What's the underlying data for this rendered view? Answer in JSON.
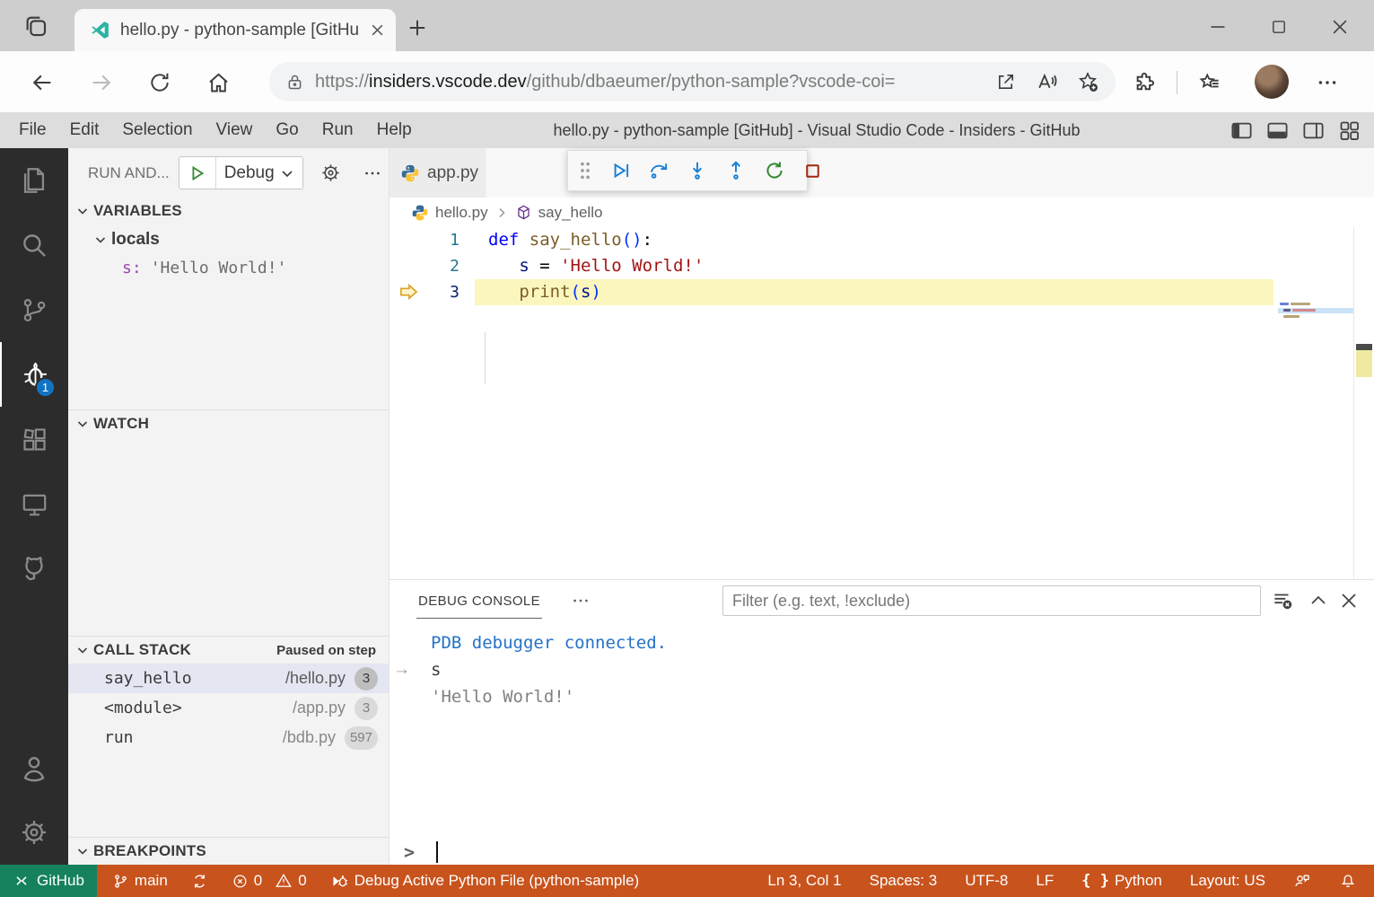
{
  "browser": {
    "tab_title": "hello.py - python-sample [GitHu",
    "url": {
      "protocol": "https://",
      "host": "insiders.vscode.dev",
      "path": "/github/dbaeumer/python-sample?vscode-coi="
    }
  },
  "titlebar": {
    "menus": [
      "File",
      "Edit",
      "Selection",
      "View",
      "Go",
      "Run",
      "Help"
    ],
    "window_title": "hello.py - python-sample [GitHub] - Visual Studio Code - Insiders - GitHub"
  },
  "activity_bar": {
    "debug_badge": "1"
  },
  "sidebar": {
    "run_panel_label": "RUN AND...",
    "debug_config": "Debug",
    "variables": {
      "title": "VARIABLES",
      "scope": "locals",
      "variable_name": "s:",
      "variable_value": "'Hello World!'"
    },
    "watch": {
      "title": "WATCH"
    },
    "call_stack": {
      "title": "CALL STACK",
      "status": "Paused on step",
      "frames": [
        {
          "name": "say_hello",
          "file": "/hello.py",
          "line": "3",
          "selected": true
        },
        {
          "name": "<module>",
          "file": "/app.py",
          "line": "3",
          "selected": false
        },
        {
          "name": "run",
          "file": "/bdb.py",
          "line": "597",
          "selected": false
        }
      ]
    },
    "breakpoints": {
      "title": "BREAKPOINTS"
    }
  },
  "editor": {
    "tab_label": "app.py",
    "breadcrumb": {
      "file": "hello.py",
      "symbol": "say_hello"
    },
    "token_colors": {
      "kw": "#0000FF",
      "fn": "#795E26",
      "brk": "#0431FA",
      "var": "#001080",
      "str": "#A31515",
      "pln": "#000000"
    },
    "code_lines": [
      {
        "num": "1",
        "current": false,
        "tokens": [
          [
            "def",
            "kw"
          ],
          [
            " ",
            "pln"
          ],
          [
            "say_hello",
            "fn"
          ],
          [
            "()",
            "brk"
          ],
          [
            ":",
            "pln"
          ]
        ]
      },
      {
        "num": "2",
        "current": false,
        "tokens": [
          [
            "   ",
            "pln"
          ],
          [
            "s",
            "var"
          ],
          [
            " = ",
            "pln"
          ],
          [
            "'Hello World!'",
            "str"
          ]
        ]
      },
      {
        "num": "3",
        "current": true,
        "tokens": [
          [
            "   ",
            "pln"
          ],
          [
            "print",
            "fn"
          ],
          [
            "(",
            "brk"
          ],
          [
            "s",
            "var"
          ],
          [
            ")",
            "brk"
          ]
        ]
      }
    ]
  },
  "panel": {
    "tab": "DEBUG CONSOLE",
    "filter_placeholder": "Filter (e.g. text, !exclude)",
    "output": [
      {
        "text": "PDB debugger connected.",
        "kind": "info",
        "marker": false
      },
      {
        "text": "s",
        "kind": "input",
        "marker": true
      },
      {
        "text": "'Hello World!'",
        "kind": "string",
        "marker": false
      }
    ],
    "prompt": ">"
  },
  "status_bar": {
    "remote": "GitHub",
    "branch": "main",
    "errors": "0",
    "warnings": "0",
    "debug_status": "Debug Active Python File (python-sample)",
    "cursor": "Ln 3, Col 1",
    "indent": "Spaces: 3",
    "encoding": "UTF-8",
    "eol": "LF",
    "language": "Python",
    "keyboard_layout": "Layout: US"
  },
  "colors": {
    "statusbar_debugging": "#C8531D",
    "remote_background": "#16825D",
    "activity_badge": "#1273C3",
    "current_line_highlight": "#FBF6BE"
  }
}
